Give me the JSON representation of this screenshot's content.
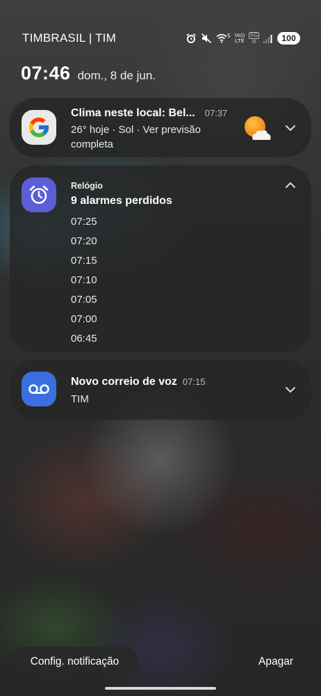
{
  "status_bar": {
    "carrier": "TIMBRASIL | TIM",
    "icons": [
      "alarm-icon",
      "mute-icon",
      "wifi-icon",
      "volte-icon",
      "no-5g-icon",
      "signal-icon"
    ],
    "wifi_label": "5",
    "volte_label_top": "Vo))",
    "volte_label_bottom": "LTE",
    "network_label": "5G",
    "battery": "100"
  },
  "lockscreen": {
    "time": "07:46",
    "date": "dom., 8 de jun."
  },
  "notifications": {
    "weather": {
      "app_icon": "google-icon",
      "title": "Clima neste local: Bel...",
      "time": "07:37",
      "body": "26° hoje · Sol · Ver previsão completa",
      "thumbnail": "sun-cloud-icon"
    },
    "clock": {
      "app_icon": "alarm-clock-icon",
      "app_name": "Relógio",
      "title": "9 alarmes perdidos",
      "alarms": [
        "07:25",
        "07:20",
        "07:15",
        "07:10",
        "07:05",
        "07:00",
        "06:45"
      ]
    },
    "voicemail": {
      "app_icon": "voicemail-icon",
      "title": "Novo correio de voz",
      "time": "07:15",
      "body": "TIM"
    }
  },
  "actions": {
    "settings_label": "Config. notificação",
    "clear_label": "Apagar"
  },
  "colors": {
    "clock_icon_bg": "#5b5fd6",
    "voicemail_icon_bg": "#3b6fe0",
    "card_bg": "#262626"
  }
}
